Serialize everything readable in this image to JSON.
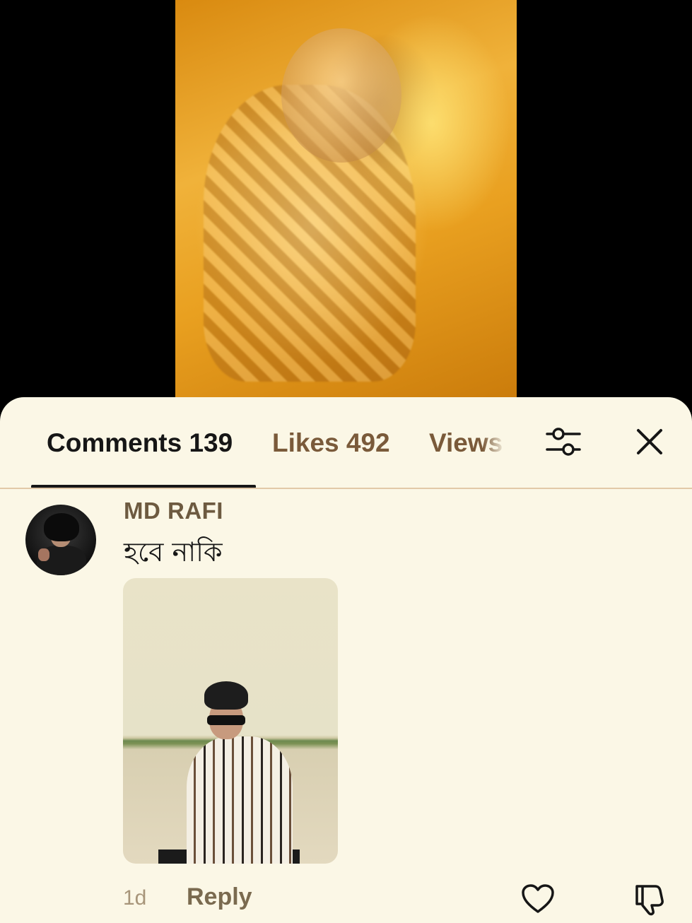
{
  "tabs": {
    "comments": "Comments 139",
    "likes": "Likes 492",
    "views": "Views"
  },
  "icons": {
    "filter": "filter-sliders-icon",
    "close": "close-icon",
    "like": "heart-icon",
    "dislike": "thumbs-down-icon"
  },
  "comment": {
    "username": "MD RAFI",
    "text": "হবে নাকি",
    "time": "1d",
    "reply_label": "Reply"
  },
  "colors": {
    "sheet_bg": "#fbf7e6",
    "active_tab": "#161616",
    "inactive_tab": "#7a5a3a",
    "username": "#6d5a40"
  }
}
